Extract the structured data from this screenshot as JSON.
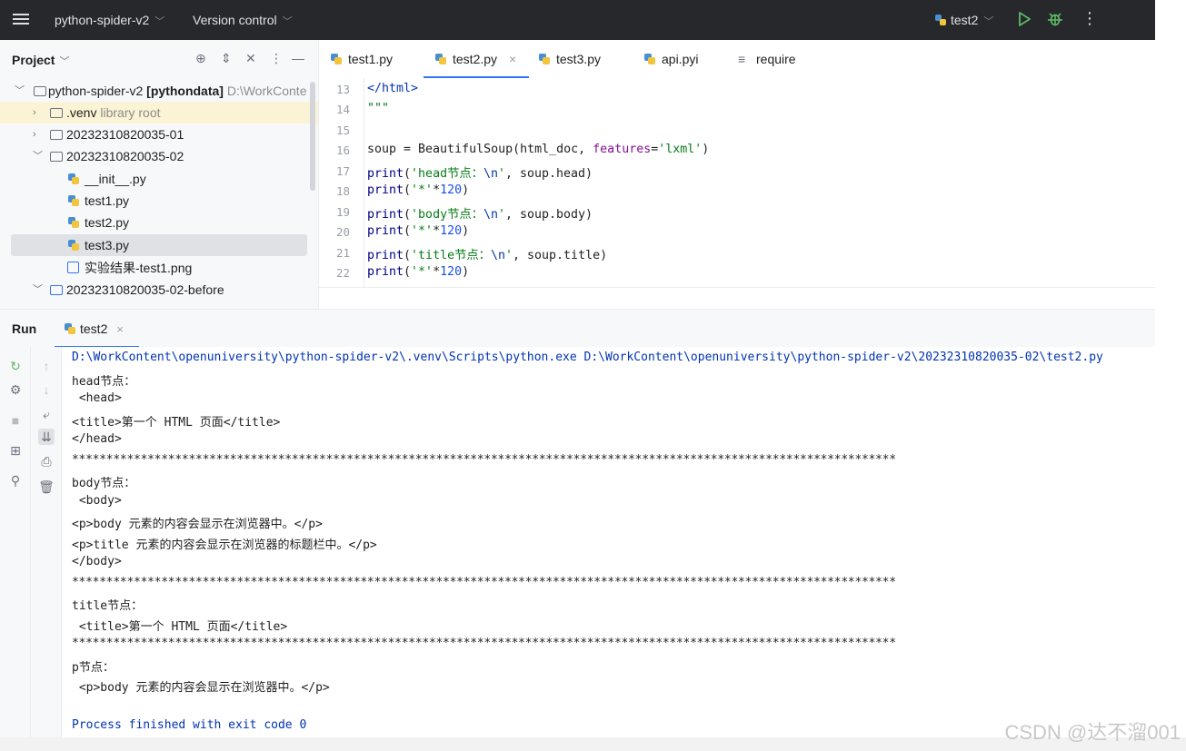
{
  "titlebar": {
    "project": "python-spider-v2",
    "version_control": "Version control",
    "run_config": "test2"
  },
  "project_pane": {
    "title": "Project",
    "tree": [
      {
        "name": "python-spider-v2",
        "bold_suffix": "[pythondata]",
        "path": "D:\\WorkConte"
      },
      {
        "name": ".venv",
        "note": "library root"
      },
      {
        "name": "20232310820035-01"
      },
      {
        "name": "20232310820035-02"
      },
      {
        "name": "__init__.py"
      },
      {
        "name": "test1.py"
      },
      {
        "name": "test2.py"
      },
      {
        "name": "test3.py"
      },
      {
        "name": "实验结果-test1.png"
      },
      {
        "name": "20232310820035-02-before"
      }
    ]
  },
  "tabs": [
    {
      "label": "test1.py"
    },
    {
      "label": "test2.py"
    },
    {
      "label": "test3.py"
    },
    {
      "label": "api.pyi"
    },
    {
      "label": "require"
    }
  ],
  "editor": {
    "line_numbers": [
      "13",
      "14",
      "15",
      "16",
      "17",
      "18",
      "19",
      "20",
      "21",
      "22"
    ]
  },
  "run_panel": {
    "title": "Run",
    "tab": "test2",
    "console": [
      "D:\\WorkContent\\openuniversity\\python-spider-v2\\.venv\\Scripts\\python.exe D:\\WorkContent\\openuniversity\\python-spider-v2\\20232310820035-02\\test2.py",
      "head节点：",
      " <head>",
      "<title>第一个 HTML 页面</title>",
      "</head>",
      "************************************************************************************************************************",
      "body节点：",
      " <body>",
      "<p>body 元素的内容会显示在浏览器中。</p>",
      "<p>title 元素的内容会显示在浏览器的标题栏中。</p>",
      "</body>",
      "************************************************************************************************************************",
      "title节点：",
      " <title>第一个 HTML 页面</title>",
      "************************************************************************************************************************",
      "p节点：",
      " <p>body 元素的内容会显示在浏览器中。</p>",
      "",
      "Process finished with exit code 0"
    ]
  },
  "watermark": "CSDN @达不溜001"
}
